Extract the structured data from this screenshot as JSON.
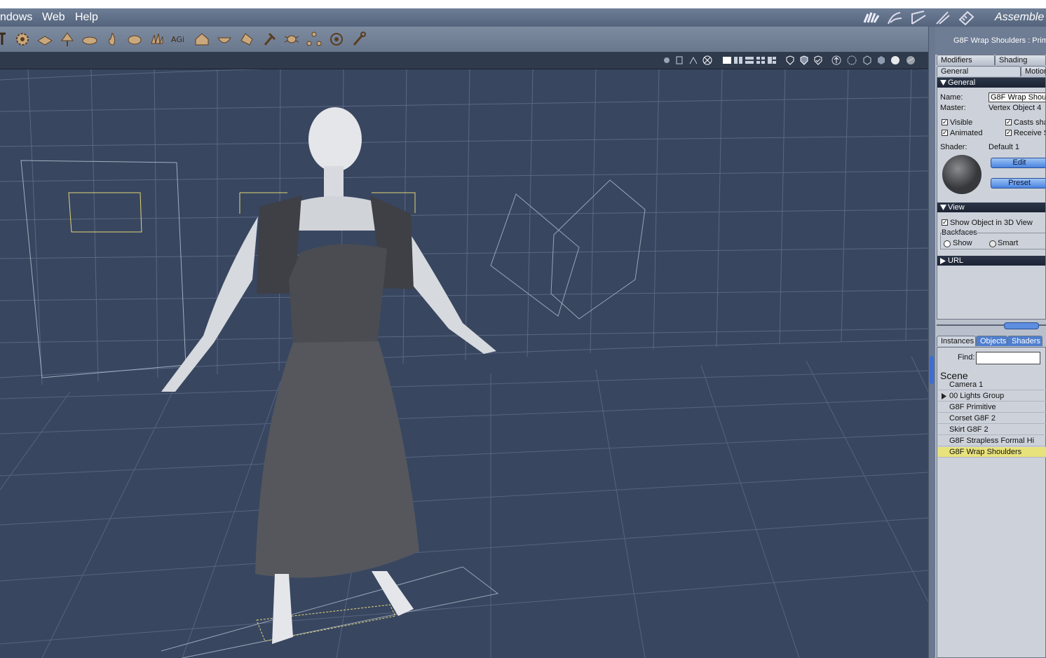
{
  "menu": {
    "windows": "ndows",
    "web": "Web",
    "help": "Help"
  },
  "room": {
    "label": "Assemble"
  },
  "panel_title": "G8F Wrap Shoulders : Prim",
  "tabs_top": [
    {
      "label": "Modifiers"
    },
    {
      "label": "Shading"
    }
  ],
  "tabs_sub": [
    {
      "label": "General"
    },
    {
      "label": "Motion"
    }
  ],
  "general": {
    "section": "General",
    "name_label": "Name:",
    "name_value": "G8F Wrap Shou",
    "master_label": "Master:",
    "master_value": "Vertex Object 4",
    "visible": "Visible",
    "casts": "Casts sha",
    "animated": "Animated",
    "receive": "Receive S",
    "shader_label": "Shader:",
    "shader_value": "Default 1",
    "edit": "Edit",
    "preset": "Preset"
  },
  "view": {
    "section": "View",
    "show_3d": "Show Object in 3D View",
    "backfaces": "Backfaces",
    "show": "Show",
    "smart": "Smart"
  },
  "url_section": "URL",
  "browser_tabs": [
    {
      "label": "Instances"
    },
    {
      "label": "Objects"
    },
    {
      "label": "Shaders"
    }
  ],
  "find_label": "Find:",
  "scene_title": "Scene",
  "scene_items": [
    {
      "label": "Camera 1"
    },
    {
      "label": "00 Lights Group"
    },
    {
      "label": "G8F Primitive"
    },
    {
      "label": "Corset G8F 2"
    },
    {
      "label": "Skirt G8F 2"
    },
    {
      "label": "G8F Strapless Formal Hi"
    },
    {
      "label": "G8F Wrap Shoulders"
    }
  ],
  "colors": {
    "viewport_bg": "#384660",
    "selection": "#e8e27c",
    "button": "#4a84e0"
  }
}
